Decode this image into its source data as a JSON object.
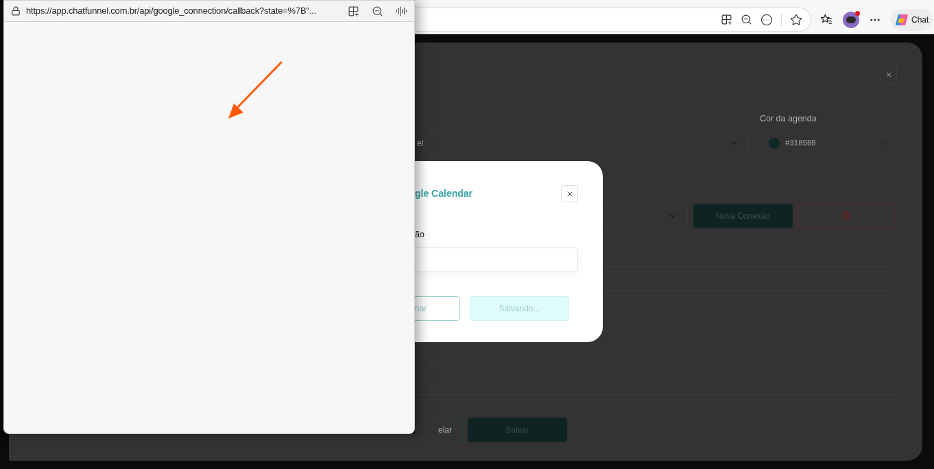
{
  "popup_window": {
    "url": "https://app.chatfunnel.com.br/api/google_connection/callback?state=%7B\"..."
  },
  "browser_toolbar": {
    "chat_label": "Chat"
  },
  "form": {
    "calendar_select_value": "el",
    "color_label": "Cor da agenda",
    "color_value": "#318988",
    "new_connection_button": "Nova Conexão",
    "footer_buttons": [
      {
        "label": "elar",
        "kind": "outline"
      },
      {
        "label": "Salvar",
        "kind": "primary"
      }
    ]
  },
  "dialog": {
    "title": "gle Calendar",
    "field_label": "ão",
    "buttons": [
      {
        "label": "nar",
        "kind": "outline"
      },
      {
        "label": "Salvando...",
        "kind": "primary"
      }
    ]
  }
}
